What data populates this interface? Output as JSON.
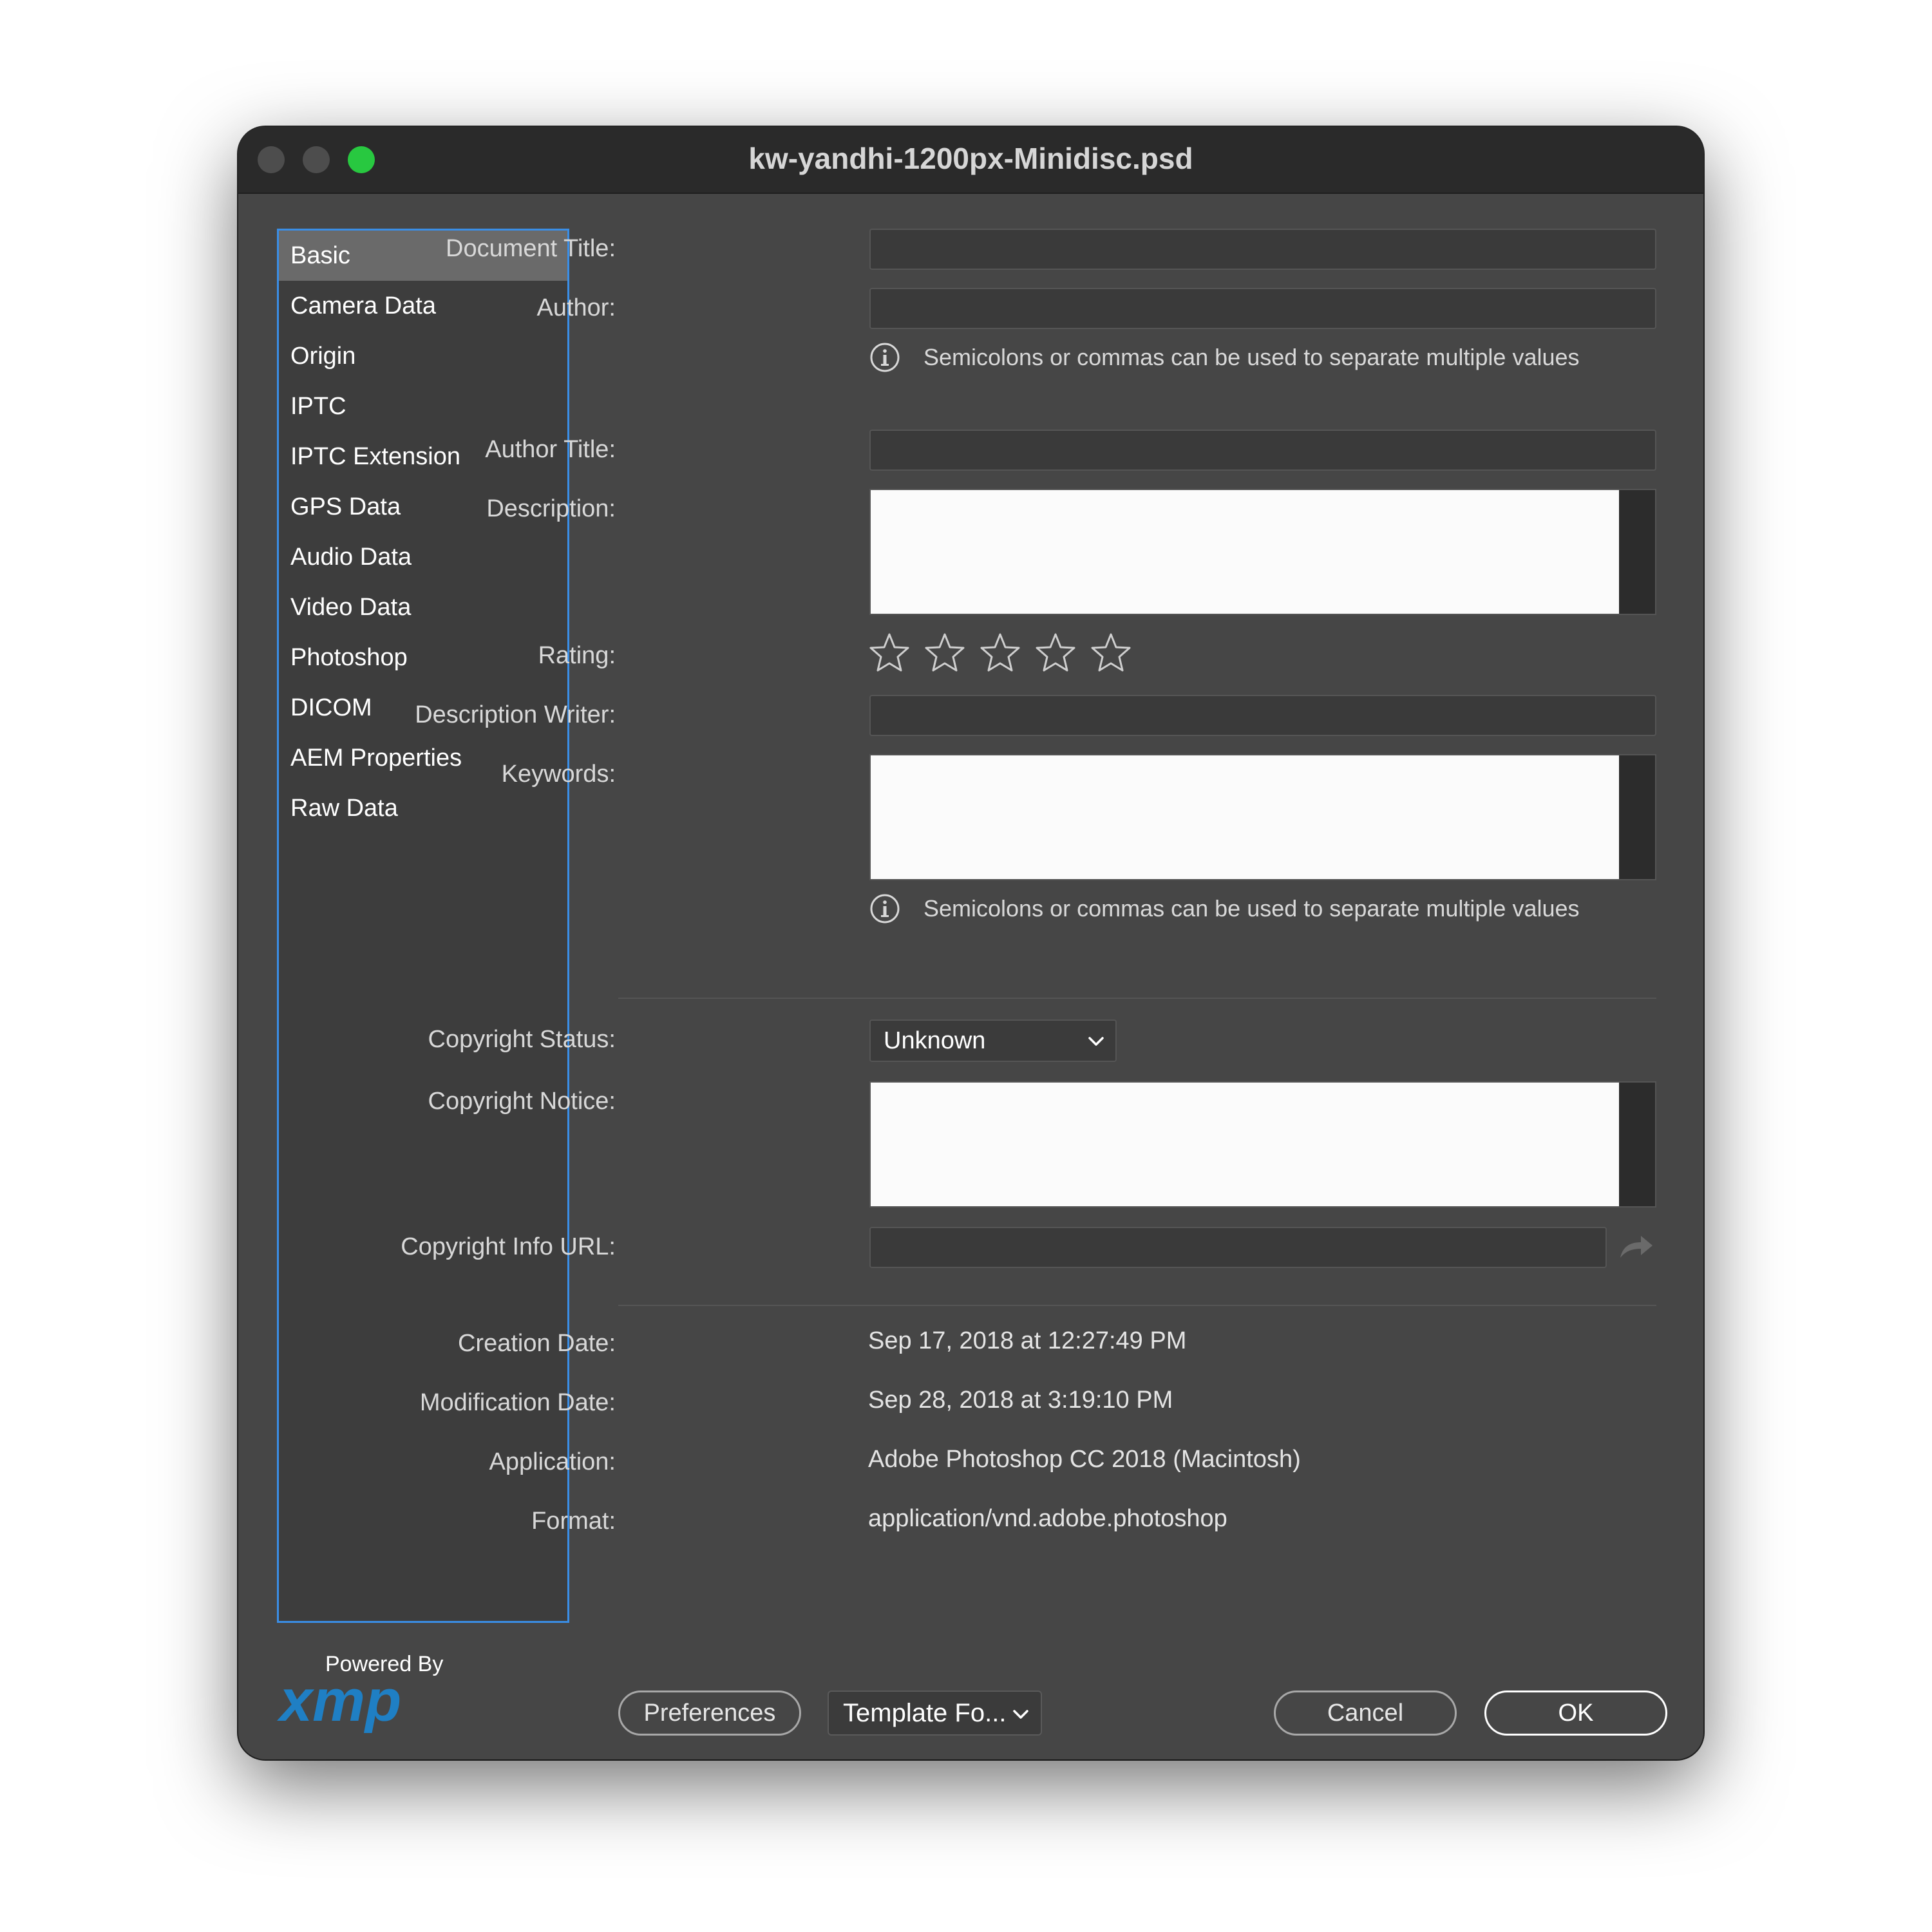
{
  "window": {
    "title": "kw-yandhi-1200px-Minidisc.psd"
  },
  "sidebar": {
    "items": [
      {
        "label": "Basic",
        "selected": true
      },
      {
        "label": "Camera Data"
      },
      {
        "label": "Origin"
      },
      {
        "label": "IPTC"
      },
      {
        "label": "IPTC Extension"
      },
      {
        "label": "GPS Data"
      },
      {
        "label": "Audio Data"
      },
      {
        "label": "Video Data"
      },
      {
        "label": "Photoshop"
      },
      {
        "label": "DICOM"
      },
      {
        "label": "AEM Properties"
      },
      {
        "label": "Raw Data"
      }
    ]
  },
  "form": {
    "document_title": {
      "label": "Document Title:",
      "value": ""
    },
    "author": {
      "label": "Author:",
      "value": ""
    },
    "author_hint": "Semicolons or commas can be used to separate multiple values",
    "author_title": {
      "label": "Author Title:",
      "value": ""
    },
    "description": {
      "label": "Description:",
      "value": ""
    },
    "rating": {
      "label": "Rating:",
      "value": 0,
      "max": 5
    },
    "description_writer": {
      "label": "Description Writer:",
      "value": ""
    },
    "keywords": {
      "label": "Keywords:",
      "value": ""
    },
    "keywords_hint": "Semicolons or commas can be used to separate multiple values",
    "copyright_status": {
      "label": "Copyright Status:",
      "value": "Unknown"
    },
    "copyright_notice": {
      "label": "Copyright Notice:",
      "value": ""
    },
    "copyright_url": {
      "label": "Copyright Info URL:",
      "value": ""
    }
  },
  "info": {
    "creation_date": {
      "label": "Creation Date:",
      "value": "Sep 17, 2018 at 12:27:49 PM"
    },
    "modification_date": {
      "label": "Modification Date:",
      "value": "Sep 28, 2018 at 3:19:10 PM"
    },
    "application": {
      "label": "Application:",
      "value": "Adobe Photoshop CC 2018 (Macintosh)"
    },
    "format": {
      "label": "Format:",
      "value": "application/vnd.adobe.photoshop"
    }
  },
  "footer": {
    "powered_by": "Powered By",
    "logo_text": "xmp",
    "preferences_label": "Preferences",
    "template_label": "Template Fo...",
    "cancel_label": "Cancel",
    "ok_label": "OK"
  },
  "icons": {
    "info": "info-circle-icon",
    "star": "star-outline-icon",
    "chevron": "chevron-down-icon",
    "share": "share-arrow-icon"
  },
  "colors": {
    "window_bg": "#464646",
    "titlebar": "#2a2a2a",
    "sidebar_border": "#3a8ee6",
    "selected_item": "#6a6a6a",
    "traffic_green": "#28c840",
    "xmp_logo": "#1f7fc4"
  }
}
